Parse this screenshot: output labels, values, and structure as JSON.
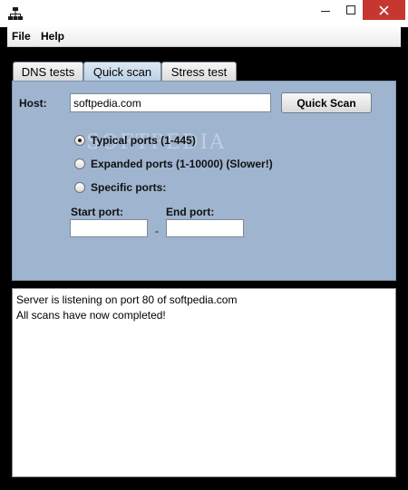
{
  "window": {
    "title": ""
  },
  "menu": {
    "file": "File",
    "help": "Help"
  },
  "tabs": [
    {
      "label": "DNS tests",
      "active": false
    },
    {
      "label": "Quick scan",
      "active": true
    },
    {
      "label": "Stress test",
      "active": false
    }
  ],
  "quick_scan": {
    "host_label": "Host:",
    "host_value": "softpedia.com",
    "scan_button": "Quick Scan",
    "options": [
      {
        "label": "Typical ports (1-445)",
        "selected": true
      },
      {
        "label": "Expanded ports (1-10000) (Slower!)",
        "selected": false
      },
      {
        "label": "Specific ports:",
        "selected": false
      }
    ],
    "start_port_label": "Start port:",
    "end_port_label": "End port:",
    "start_port_value": "",
    "end_port_value": "",
    "range_dash": "-"
  },
  "log": {
    "lines": [
      "Server is listening on port 80 of softpedia.com",
      "All scans have now completed!"
    ]
  },
  "colors": {
    "panel": "#9fb4cf",
    "frame": "#000000",
    "close_button": "#c7372f"
  },
  "icons": [
    "network-icon",
    "minimize-icon",
    "maximize-icon",
    "close-icon"
  ]
}
